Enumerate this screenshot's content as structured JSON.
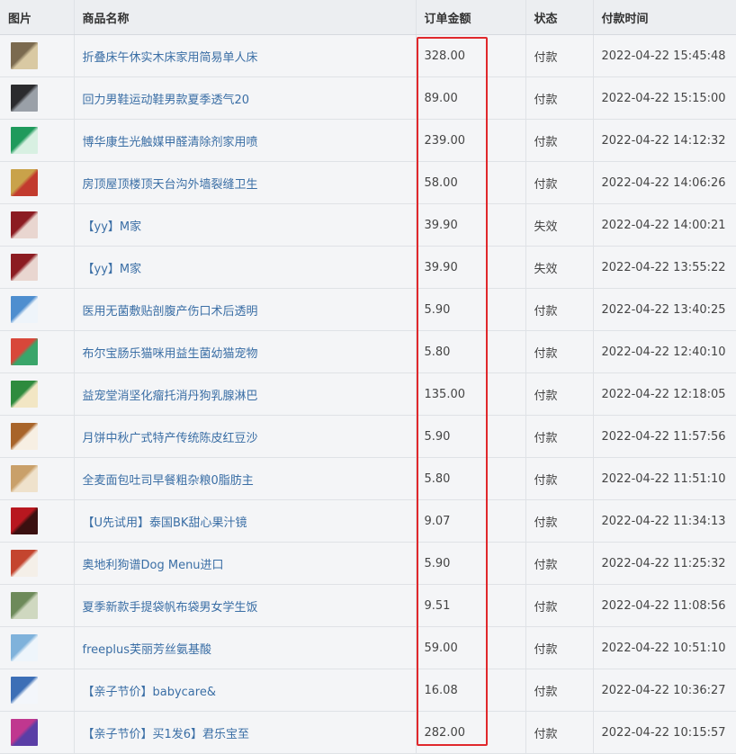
{
  "table": {
    "headers": {
      "image": "图片",
      "name": "商品名称",
      "amount": "订单金额",
      "status": "状态",
      "time": "付款时间"
    },
    "rows": [
      {
        "name": "折叠床午休实木床家用简易单人床",
        "amount": "328.00",
        "status": "付款",
        "time": "2022-04-22 15:45:48",
        "thumb_colors": [
          "#7b6a4f",
          "#d9c9a3"
        ]
      },
      {
        "name": "回力男鞋运动鞋男款夏季透气20",
        "amount": "89.00",
        "status": "付款",
        "time": "2022-04-22 15:15:00",
        "thumb_colors": [
          "#2b2b2e",
          "#9aa0a8"
        ]
      },
      {
        "name": "博华康生光触媒甲醛清除剂家用喷",
        "amount": "239.00",
        "status": "付款",
        "time": "2022-04-22 14:12:32",
        "thumb_colors": [
          "#1f9a5c",
          "#d8f0e2"
        ]
      },
      {
        "name": "房顶屋顶楼顶天台沟外墙裂缝卫生",
        "amount": "58.00",
        "status": "付款",
        "time": "2022-04-22 14:06:26",
        "thumb_colors": [
          "#c9a24a",
          "#c23b2e"
        ]
      },
      {
        "name": "【yy】M家",
        "amount": "39.90",
        "status": "失效",
        "time": "2022-04-22 14:00:21",
        "thumb_colors": [
          "#8c1c22",
          "#e9d6d0"
        ]
      },
      {
        "name": "【yy】M家",
        "amount": "39.90",
        "status": "失效",
        "time": "2022-04-22 13:55:22",
        "thumb_colors": [
          "#8c1c22",
          "#e9d6d0"
        ]
      },
      {
        "name": "医用无菌敷贴剖腹产伤口术后透明",
        "amount": "5.90",
        "status": "付款",
        "time": "2022-04-22 13:40:25",
        "thumb_colors": [
          "#4e8ecf",
          "#eef4fa"
        ]
      },
      {
        "name": "布尔宝肠乐猫咪用益生菌幼猫宠物",
        "amount": "5.80",
        "status": "付款",
        "time": "2022-04-22 12:40:10",
        "thumb_colors": [
          "#d8473a",
          "#3aa56a"
        ]
      },
      {
        "name": "益宠堂消坚化瘤托消丹狗乳腺淋巴",
        "amount": "135.00",
        "status": "付款",
        "time": "2022-04-22 12:18:05",
        "thumb_colors": [
          "#2e8b3e",
          "#f2e6c4"
        ]
      },
      {
        "name": "月饼中秋广式特产传统陈皮红豆沙",
        "amount": "5.90",
        "status": "付款",
        "time": "2022-04-22 11:57:56",
        "thumb_colors": [
          "#a8642a",
          "#f7efe3"
        ]
      },
      {
        "name": "全麦面包吐司早餐粗杂粮0脂肪主",
        "amount": "5.80",
        "status": "付款",
        "time": "2022-04-22 11:51:10",
        "thumb_colors": [
          "#c9a06a",
          "#efe2cc"
        ]
      },
      {
        "name": "【U先试用】泰国BK甜心果汁镜",
        "amount": "9.07",
        "status": "付款",
        "time": "2022-04-22 11:34:13",
        "thumb_colors": [
          "#b8171f",
          "#3a1010"
        ]
      },
      {
        "name": "奥地利狗谱Dog Menu进口",
        "amount": "5.90",
        "status": "付款",
        "time": "2022-04-22 11:25:32",
        "thumb_colors": [
          "#c4452f",
          "#f4efe8"
        ]
      },
      {
        "name": "夏季新款手提袋帆布袋男女学生饭",
        "amount": "9.51",
        "status": "付款",
        "time": "2022-04-22 11:08:56",
        "thumb_colors": [
          "#6d8a5a",
          "#cfd8c0"
        ]
      },
      {
        "name": "freeplus芙丽芳丝氨基酸",
        "amount": "59.00",
        "status": "付款",
        "time": "2022-04-22 10:51:10",
        "thumb_colors": [
          "#7fb2db",
          "#eef5fb"
        ]
      },
      {
        "name": "【亲子节价】babycare&",
        "amount": "16.08",
        "status": "付款",
        "time": "2022-04-22 10:36:27",
        "thumb_colors": [
          "#3d6fb6",
          "#f3f6fb"
        ]
      },
      {
        "name": "【亲子节价】买1发6】君乐宝至",
        "amount": "282.00",
        "status": "付款",
        "time": "2022-04-22 10:15:57",
        "thumb_colors": [
          "#c0378f",
          "#5a3ea6"
        ]
      }
    ]
  },
  "colors": {
    "link": "#3a6ea5",
    "highlight": "#e0282c"
  }
}
